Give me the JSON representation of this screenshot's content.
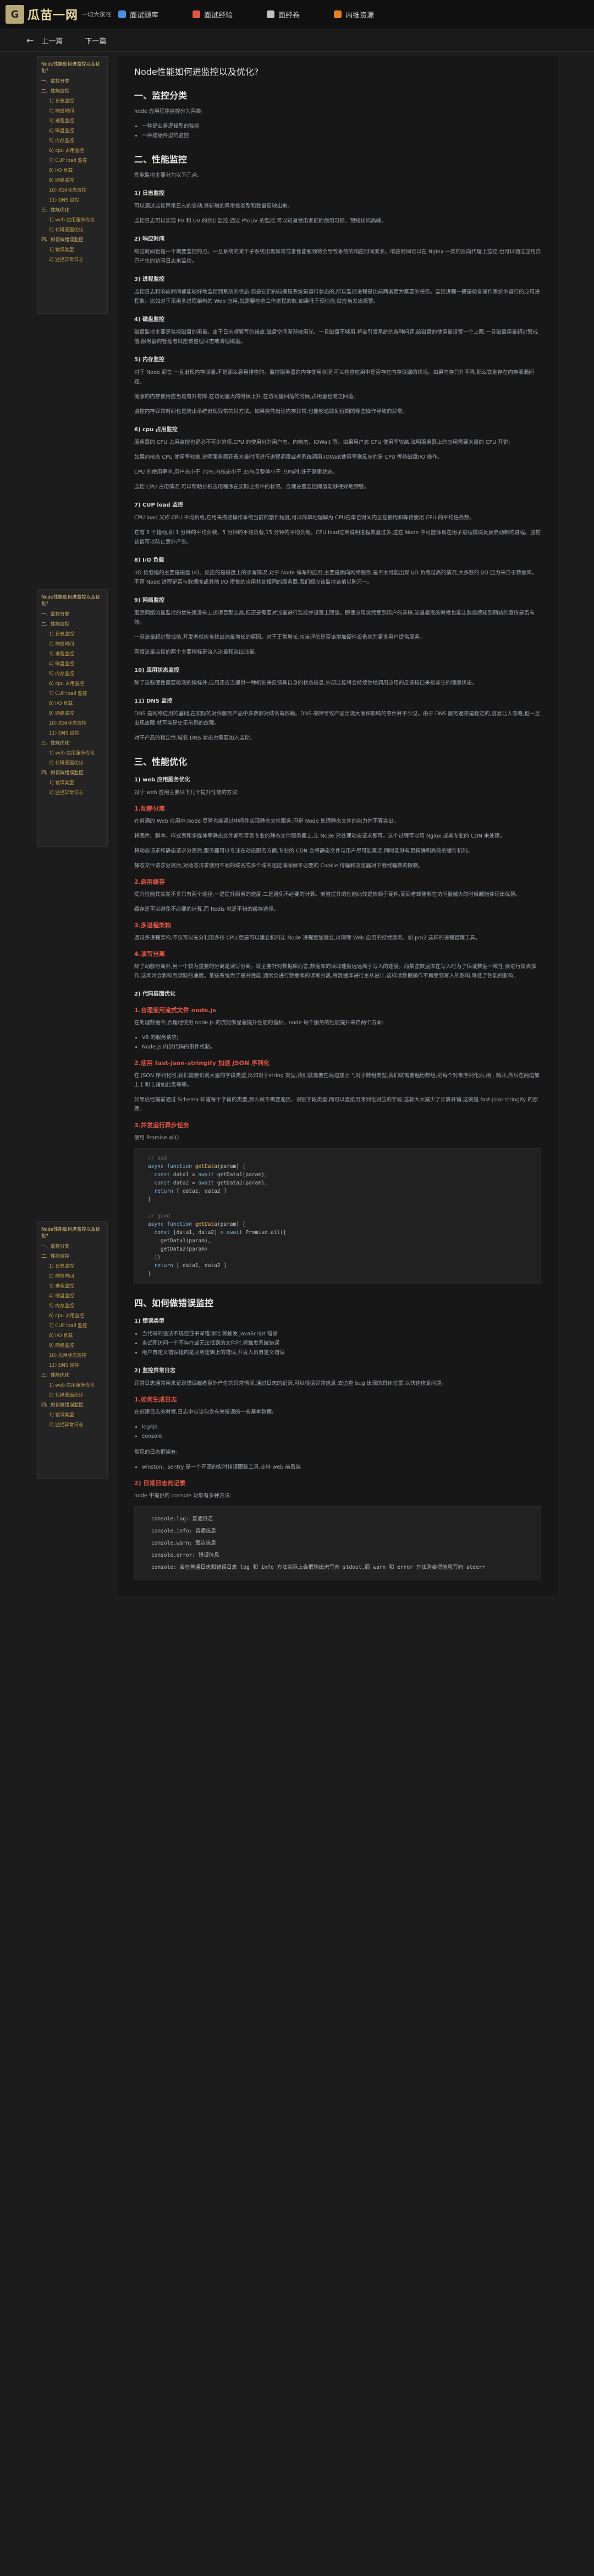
{
  "header": {
    "logo_mark": "G",
    "logo_text": "瓜苗一网",
    "logo_sub": "一切大家在",
    "nav": [
      {
        "label": "面试题库",
        "color": "#4a90e2"
      },
      {
        "label": "面试经验",
        "color": "#e25545"
      },
      {
        "label": "面经卷",
        "color": "#c0c0c0"
      },
      {
        "label": "内推资源",
        "color": "#e67e22"
      }
    ]
  },
  "subbar": {
    "back": "←",
    "prev": "上一篇",
    "next": "下一篇"
  },
  "toc": {
    "title": "Node性能如何进监控以及优化?",
    "items": [
      {
        "t": "h",
        "label": "一、监控分类"
      },
      {
        "t": "h",
        "label": "二、性能监控"
      },
      {
        "t": "s",
        "label": "1) 日志监控"
      },
      {
        "t": "s",
        "label": "2) 响应时间"
      },
      {
        "t": "s",
        "label": "3) 进程监控"
      },
      {
        "t": "s",
        "label": "4) 磁盘监控"
      },
      {
        "t": "s",
        "label": "5) 内存监控"
      },
      {
        "t": "s",
        "label": "6) cpu 占用监控"
      },
      {
        "t": "s",
        "label": "7) CUP load 监控"
      },
      {
        "t": "s",
        "label": "8) I/O 负载"
      },
      {
        "t": "s",
        "label": "9) 网络监控"
      },
      {
        "t": "s",
        "label": "10) 应用状态监控"
      },
      {
        "t": "s",
        "label": "11) DNS 监控"
      },
      {
        "t": "h",
        "label": "三、性能优化"
      },
      {
        "t": "s",
        "label": "1) web 应用服务优化"
      },
      {
        "t": "s",
        "label": "2) 代码层面优化"
      },
      {
        "t": "h",
        "label": "四、如何做错误监控"
      },
      {
        "t": "s",
        "label": "1) 错误类型"
      },
      {
        "t": "s",
        "label": "2) 监控异常日志"
      }
    ]
  },
  "content": {
    "title": "Node性能如何进监控以及优化?",
    "s1": "一、监控分类",
    "s1_p": "node 应用程序监控分为两类:",
    "s1_list": [
      "一种是业务逻辑型的监控",
      "一种是硬件型的监控"
    ],
    "s2": "二、性能监控",
    "s2_p": "性能监控主要分为以下几点:",
    "m1": "1) 日志监控",
    "m1_p1": "可以通过监控异常日志的变动,将新增的异常按类型和数量反映出来。",
    "m1_p2": "监控日志可以实现 PV 和 UV 的统计监控,通过 PV/UV 的监控,可以知道使用者们的使用习惯、预知访问高峰。",
    "m2": "2) 响应时间",
    "m2_p": "响应时间也是一个需要监控的点。一旦系统的某个子系统出现异常或者性能瓶颈将会导致系统的响应时间变长。响应时间可以在 Nginx 一类的反向代理上监控,也可以通过应用自己产生的访问日志来监控。",
    "m3": "3) 进程监控",
    "m3_p": "监控日志和响应时间都能较好地监控到系统的状态,但是它们的前提是系统是运行状态的,所以监控进程是比前两者更为紧要的任务。监控进程一般是检查操作系统中运行的应用进程数。比如对于采用多进程架构的 Web 应用,就需要检查工作进程的数,如果低于预估值,就应当发出报警。",
    "m4": "4) 磁盘监控",
    "m4_p": "磁盘监控主要是监控磁盘的用量。由于日志频繁写的缘故,磁盘空间渐渐被用光。一旦磁盘不够用,将会引发系统的各种问题,给磁盘的使用量设置一个上限,一旦磁盘用量超过警戒值,服务器的管理者就应该整理日志或清理磁盘。",
    "m5": "5) 内存监控",
    "m5_p1": "对于 Node 而言,一旦出现内存泄漏,不是那么容易排查的。监控服务器的内存使用状况,可以检查应用中是否存在内存泄漏的状况。如果内存只升不降,那么铁定存在内存泄漏问题。",
    "m5_p2": "健康的内存使用应当是有升有降,在访问量大的时候上升,在访问量回落的时候,占用量也随之回落。",
    "m5_p3": "监控内存异常时间也是防止系统出现异常的好方法。如果突然出现内存异常,也能够追踪到近期的哪些操作导致的异常。",
    "m6": "6) cpu 占用监控",
    "m6_p1": "服务器的 CPU 占用监控也是必不可少的项,CPU 的使用分为用户态、内核态、IOWait 等。如果用户态 CPU 使用率较高,说明服务器上的应用需要大量的 CPU 开销;",
    "m6_p2": "如果内核态 CPU 使用率较高,说明服务器花费大量时间进行进程调度或者系统调用;IOWait使用率则反应的是 CPU 等待磁盘I/O 操作。",
    "m6_p3": "CPU 的使用率中,用户态小于 70%,内核态小于 35%且整体小于 70%时,处于健康状态。",
    "m6_p4": "监控 CPU 占用情况,可以帮助分析应用程序在实际业务中的状况。合理设置监控阈值能够很好地预警。",
    "m7": "7) CUP load 监控",
    "m7_p1": "CPU load 又称 CPU 平均负载,它用来描述操作系统当前的繁忙程度,可以简单地理解为 CPU在单位时间内正在使用和等待使用 CPU 的平均任务数。",
    "m7_p2": "它有 3 个指标,即 1 分钟的平均负载、5 分钟的平均负载,15 分钟的平均负载。CPU load过高说明进程数量过多,这在 Node 中可能体现在用子进程模块反复启动新的进程。监控该值可以防止意外产生。",
    "m8": "8) I/O 负载",
    "m8_p": "I/O 负载指的主要是磁盘 I/O。反应的是磁盘上的读写情况,对于 Node 编写的应用,主要是面向网络服务,是不太可能出现 I/O 负载过高的情况,大多数的 I/O 压力来自于数据库。不管 Node 进程是否与数据库或其他 I/O 密集的应用共处相同的服务器,我们都应该监控该值以防万一。",
    "m9": "9) 网络监控",
    "m9_p1": "虽然网络流量监控的优先级没有上述项目那么高,但还是需要对流量进行监控并设置上限值。即便应用突然受到用户的青睐,流量暴涨的时候也能让数值感知到网站的宣传是否有效。",
    "m9_p2": "一旦流量超过警戒值,开发者就应当找出流量增长的原因。对于正常增长,应当评估是否该增加硬件设备来为更多用户提供服务。",
    "m9_p3": "网络流量监控的两个主要指标是流入流量和流出流量。",
    "m10": "10) 应用状态监控",
    "m10_p1": "除了这些硬性需要检测的指标外,应用还应当提供一种机制来反馈其自身的状态信息,外部监控将会持续性地调用应用的反馈接口来检查它的健康状态。",
    "m11": "11) DNS 监控",
    "m11_p1": "DNS 是网络应用的基础,在实际的对外服务产品中多数都对域名有依赖。DNS 故障导致产品出现大面积影响的事件并不少见。由于 DNS 服务通常是稳定的,容易让人忽略,但一旦出现故障,就可能是史无前例的故障。",
    "m11_p2": "对于产品的稳定性,域名 DNS 状态也需要加入监控。",
    "s3": "三、性能优化",
    "o1": "1) web 应用服务优化",
    "o1_p": "对于 web 应用主要以下几个提升性能的方法:",
    "o1_r1": "1.动静分离",
    "o1_r1_p1": "在普通的 Web 应用中,Node 尽管也能通过中间件实现静态文件服务,但是 Node 处理静态文件的能力并不算突出。",
    "o1_r1_p2": "将图片、脚本、样式表和多媒体等静态文件都引导到专业的静态文件服务器上,让 Node 只处理动态请求即可。这个过程可以用 Nginx 或者专业的 CDN 来处理。",
    "o1_r1_p3": "将动态请求和静态请求分离后,服务器可以专注在动态服务方面,专业的 CDN 会将静态文件与用户尽可能靠近,同时能够有更精确和高效的缓存机制。",
    "o1_r1_p4": "静态文件请求分离后,对动态请求使用不同的域名或多个域名还能消除掉不必要的 Cookie 传输和浏览器对下载线程数的限制。",
    "o1_r2": "2.启用缓存",
    "o1_r2_p1": "提升性能其实差不多只有两个途径,一是提升服务的速度,二是避免不必要的计算。前者提升的性能比较是依赖于硬件,而后者却能够在访问量越大的时候越能体现出优势。",
    "o1_r2_p2": "缓存是可以避免不必要的计算,而 Redis 就是不错的缓存选择。",
    "o1_r3": "3.多进程架构",
    "o1_r3_p1": "通过多进程架构,不仅可以充分利用多核 CPU,更是可以建立机制让 Node 进程更加健壮,以保障 Web 应用的持续服务。如:pm2 这样的进程管理工具。",
    "o1_r4": "4.读写分离",
    "o1_r4_p1": "除了动静分离外,另一个较为重要的分离是读写分离。就主要针对数据库而言,数据库的读取速度远远高于写入的速度。而某些数据库在写入时为了保证数据一致性,会进行锁表操作,这同时会影响到读取的速度。某些系统为了提升性能,通常会进行数据库的读写分离,将数据库进行主从设计,这样读数据操作不再受到写入的影响,降低了性能的影响。",
    "o2": "2) 代码层面优化",
    "o2_r1": "1.合理使用流式文件 node.js",
    "o2_r1_p": "在处理数据中,合理地使用 node.js 的流能够显著提升性能的指标。node 每个服务的性能提升来自两个方面:",
    "o2_r1_list": [
      "V8 的服务请求;",
      "Node.js 内部代码的事件机制。"
    ],
    "o2_r2": "2.使用 fast-json-stringify 加速 JSON 序列化",
    "o2_r2_p1": "在 JSON 序列化时,我们需要识别大量的字段类型,比如对于string 类型,我们就需要在两边加上 \",对于数组类型,我们就需要遍历数组,把每个对象序列化后,用 , 隔开,然后在两边加上 [ 和 ],诸如此类等等。",
    "o2_r2_p2": "如果已经提前通过 Schema 知道每个字段的类型,那么就不需要遍历、识别字段类型,而可以直接用序列化对应的字段,这就大大减少了计算开销,这就是 fast-json-stringify 的原理。",
    "o2_r3": "3.并发运行异步任务",
    "o2_r3_p": "使用 Promise.all()",
    "s4": "四、如何做错误监控",
    "e1": "1) 错误类型",
    "e1_list": [
      "当代码的语法不规范或书写错误时,将触发 JavaScript 错误",
      "当试图访问一个不存在或无法找到的文件时,将触发系统错误",
      "用户自定义错误指的是业务逻辑上的错误,开发人员自定义错误"
    ],
    "e2": "2) 监控异常日志",
    "e2_p1": "异常日志通常用来记录错误或者意外产生的异常情况,通过日志的记录,可以根据异常信息,去追查 bug 出现的具体位置,以快速修复问题。",
    "e2_r1": "1.如何生成日志",
    "e2_r1_p": "在创建日志的时候,日志中应该包含有关错误的一些基本数据:",
    "e2_r1_list": [
      "log4js",
      "console"
    ],
    "e2_r1_p2": "常见的日志框架有:",
    "e2_r1_list2": [
      "winston、sentry 是一个开源的实时错误跟踪工具,支持 web 前后端"
    ],
    "e2_r2": "2) 日常日志的记录",
    "e2_r2_p": "node 中提供的 console 对象有多种方法:",
    "e2_r2_code": [
      "console.log: 普通日志",
      "console.info: 普通信息",
      "console.warn: 警告信息",
      "console.error: 错误信息",
      "console: 会在普通日志和错误日志 log 和 info 方法实际上会把输出流写向 stdout,而 warn 和 error 方法则会把信息写向 stderr"
    ]
  }
}
